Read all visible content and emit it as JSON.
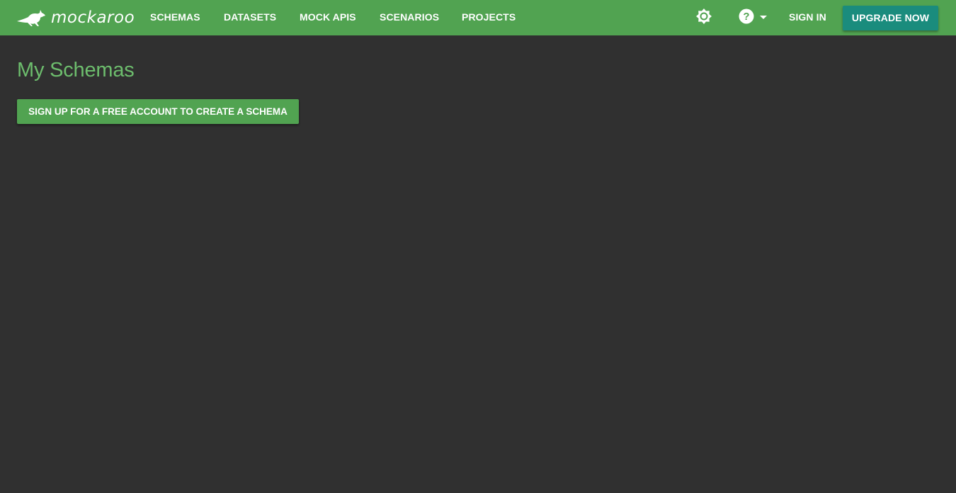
{
  "brand": {
    "name": "mockaroo",
    "logo_icon": "kangaroo-icon"
  },
  "nav": {
    "items": [
      {
        "label": "SCHEMAS"
      },
      {
        "label": "DATASETS"
      },
      {
        "label": "MOCK APIS"
      },
      {
        "label": "SCENARIOS"
      },
      {
        "label": "PROJECTS"
      }
    ],
    "theme_icon": "theme-toggle-icon",
    "help_icon": "help-icon",
    "sign_in_label": "SIGN IN",
    "upgrade_label": "UPGRADE NOW"
  },
  "main": {
    "title": "My Schemas",
    "signup_button_label": "SIGN UP FOR A FREE ACCOUNT TO CREATE A SCHEMA"
  },
  "colors": {
    "header_bg": "#51a351",
    "page_bg": "#303030",
    "title_color": "#6dbd6d",
    "upgrade_bg": "#1a8c7d",
    "signup_bg": "#51a351"
  }
}
